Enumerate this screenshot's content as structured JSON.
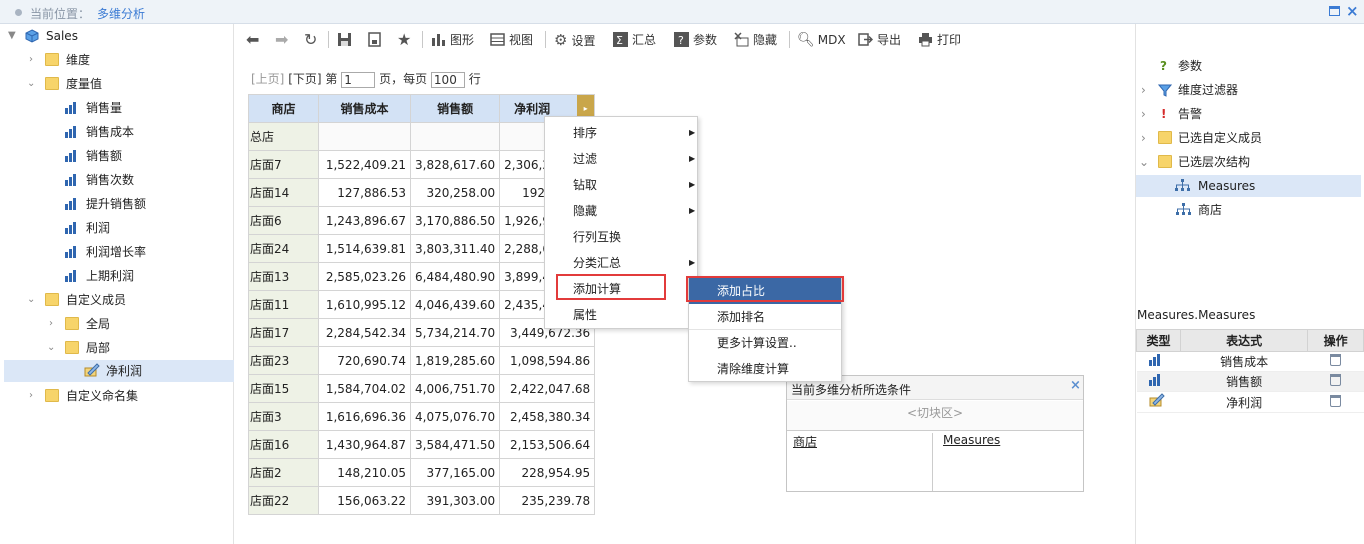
{
  "topbar": {
    "location_label": "当前位置：",
    "current_page": "多维分析"
  },
  "tree": {
    "root": "Sales",
    "dimension": "维度",
    "measures_folder": "度量值",
    "measures": [
      "销售量",
      "销售成本",
      "销售额",
      "销售次数",
      "提升销售额",
      "利润",
      "利润增长率",
      "上期利润"
    ],
    "custom_members": "自定义成员",
    "global": "全局",
    "local": "局部",
    "net_profit": "净利润",
    "custom_named_sets": "自定义命名集"
  },
  "toolbar": {
    "chart": "图形",
    "view": "视图",
    "settings": "设置",
    "summary": "汇总",
    "params": "参数",
    "hide": "隐藏",
    "mdx": "MDX",
    "export": "导出",
    "print": "打印"
  },
  "pager": {
    "prev": "[上页]",
    "next": "[下页]",
    "page_prefix": "第",
    "page_value": "1",
    "page_suffix": "页，每页",
    "per_page_value": "100",
    "row_suffix": "行"
  },
  "grid": {
    "headers": [
      "商店",
      "销售成本",
      "销售额",
      "净利润"
    ],
    "total_label": "总店",
    "rows": [
      [
        "店面7",
        "1,522,409.21",
        "3,828,617.60",
        "2,306,2"
      ],
      [
        "店面14",
        "127,886.53",
        "320,258.00",
        "192,"
      ],
      [
        "店面6",
        "1,243,896.67",
        "3,170,886.50",
        "1,926,9"
      ],
      [
        "店面24",
        "1,514,639.81",
        "3,803,311.40",
        "2,288,6"
      ],
      [
        "店面13",
        "2,585,023.26",
        "6,484,480.90",
        "3,899,4"
      ],
      [
        "店面11",
        "1,610,995.12",
        "4,046,439.60",
        "2,435,4"
      ],
      [
        "店面17",
        "2,284,542.34",
        "5,734,214.70",
        "3,449,672.36"
      ],
      [
        "店面23",
        "720,690.74",
        "1,819,285.60",
        "1,098,594.86"
      ],
      [
        "店面15",
        "1,584,704.02",
        "4,006,751.70",
        "2,422,047.68"
      ],
      [
        "店面3",
        "1,616,696.36",
        "4,075,076.70",
        "2,458,380.34"
      ],
      [
        "店面16",
        "1,430,964.87",
        "3,584,471.50",
        "2,153,506.64"
      ],
      [
        "店面2",
        "148,210.05",
        "377,165.00",
        "228,954.95"
      ],
      [
        "店面22",
        "156,063.22",
        "391,303.00",
        "235,239.78"
      ]
    ]
  },
  "context_menu": {
    "items": [
      "排序",
      "过滤",
      "钻取",
      "隐藏",
      "行列互换",
      "分类汇总",
      "添加计算",
      "属性"
    ]
  },
  "submenu": {
    "items": [
      "添加占比",
      "添加排名",
      "更多计算设置..",
      "清除维度计算"
    ]
  },
  "condition_panel": {
    "title": "当前多维分析所选条件",
    "slicer": "<切块区>",
    "row_dim": "商店",
    "col_dim": "Measures"
  },
  "right_panel": {
    "params": "参数",
    "dim_filter": "维度过滤器",
    "alert": "告警",
    "selected_custom_members": "已选自定义成员",
    "selected_hierarchy": "已选层次结构",
    "measures_node": "Measures",
    "store_node": "商店",
    "section_title": "Measures.Measures",
    "table_headers": [
      "类型",
      "表达式",
      "操作"
    ],
    "table_rows": [
      "销售成本",
      "销售额",
      "净利润"
    ]
  }
}
